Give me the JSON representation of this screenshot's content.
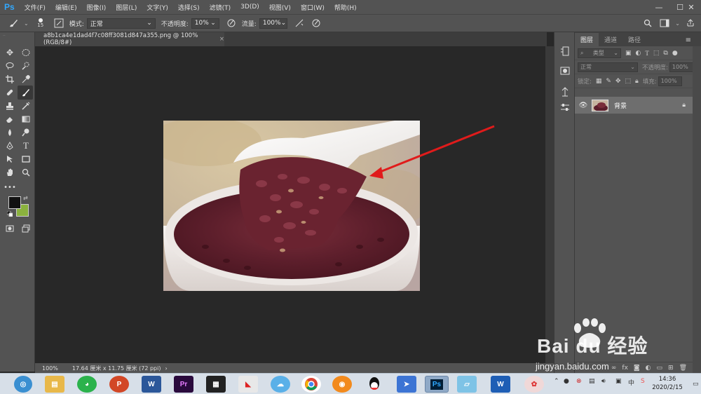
{
  "app": {
    "logo": "Ps"
  },
  "menu": [
    "文件(F)",
    "编辑(E)",
    "图像(I)",
    "图层(L)",
    "文字(Y)",
    "选择(S)",
    "滤镜(T)",
    "3D(D)",
    "视图(V)",
    "窗口(W)",
    "帮助(H)"
  ],
  "window_controls": {
    "minimize": "—",
    "maximize": "☐",
    "close": "✕"
  },
  "options": {
    "brush_size": "15",
    "mode_label": "模式:",
    "mode_value": "正常",
    "opacity_label": "不透明度:",
    "opacity_value": "10%",
    "flow_label": "流量:",
    "flow_value": "100%"
  },
  "document": {
    "tab_title": "a8b1ca4e1dad4f7c08ff3081d847a355.png @ 100%(RGB/8#)",
    "close": "×"
  },
  "status": {
    "zoom": "100%",
    "doc_info": "17.64 厘米 x 11.75 厘米 (72 ppi)",
    "arrow": "›"
  },
  "layers_panel": {
    "tabs": [
      "图层",
      "通道",
      "路径"
    ],
    "active_tab": 0,
    "filter_placeholder": "类型",
    "blend_mode": "正常",
    "opacity_label": "不透明度:",
    "opacity_value": "100%",
    "lock_label": "锁定:",
    "fill_label": "填充:",
    "fill_value": "100%",
    "layers": [
      {
        "name": "背景",
        "visible": true,
        "locked": true
      }
    ]
  },
  "colors": {
    "foreground": "#111111",
    "background": "#8bb23e",
    "accent": "#31a8ff"
  },
  "taskbar": {
    "clock_time": "14:36",
    "clock_date": "2020/2/15"
  },
  "watermark": {
    "brand": "Bai du 经验",
    "url": "jingyan.baidu.com"
  }
}
